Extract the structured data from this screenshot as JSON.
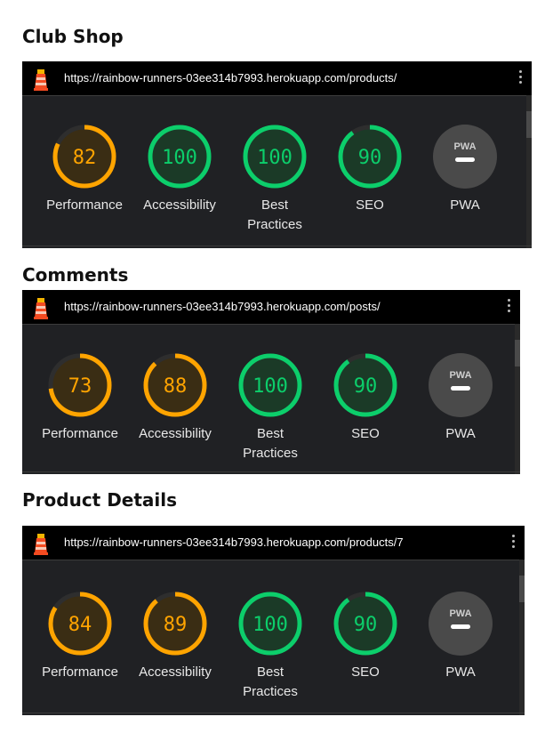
{
  "colors": {
    "pass": "#0cce6b",
    "pass_fill": "#1b3a27",
    "average": "#ffa400",
    "average_fill": "#3a2d14",
    "pwa_fill": "#4a4a4a",
    "track": "#2e2e2e"
  },
  "sections": [
    {
      "title": "Club Shop",
      "url": "https://rainbow-runners-03ee314b7993.herokuapp.com/products/",
      "gauges": [
        {
          "label": "Performance",
          "score": 82,
          "status": "average"
        },
        {
          "label": "Accessibility",
          "score": 100,
          "status": "pass"
        },
        {
          "label": "Best\nPractices",
          "score": 100,
          "status": "pass"
        },
        {
          "label": "SEO",
          "score": 90,
          "status": "pass"
        },
        {
          "label": "PWA",
          "badge": "PWA",
          "status": "pwa"
        }
      ]
    },
    {
      "title": "Comments",
      "url": "https://rainbow-runners-03ee314b7993.herokuapp.com/posts/",
      "gauges": [
        {
          "label": "Performance",
          "score": 73,
          "status": "average"
        },
        {
          "label": "Accessibility",
          "score": 88,
          "status": "average"
        },
        {
          "label": "Best\nPractices",
          "score": 100,
          "status": "pass"
        },
        {
          "label": "SEO",
          "score": 90,
          "status": "pass"
        },
        {
          "label": "PWA",
          "badge": "PWA",
          "status": "pwa"
        }
      ]
    },
    {
      "title": "Product Details",
      "url": "https://rainbow-runners-03ee314b7993.herokuapp.com/products/7",
      "gauges": [
        {
          "label": "Performance",
          "score": 84,
          "status": "average"
        },
        {
          "label": "Accessibility",
          "score": 89,
          "status": "average"
        },
        {
          "label": "Best\nPractices",
          "score": 100,
          "status": "pass"
        },
        {
          "label": "SEO",
          "score": 90,
          "status": "pass"
        },
        {
          "label": "PWA",
          "badge": "PWA",
          "status": "pwa"
        }
      ]
    }
  ]
}
